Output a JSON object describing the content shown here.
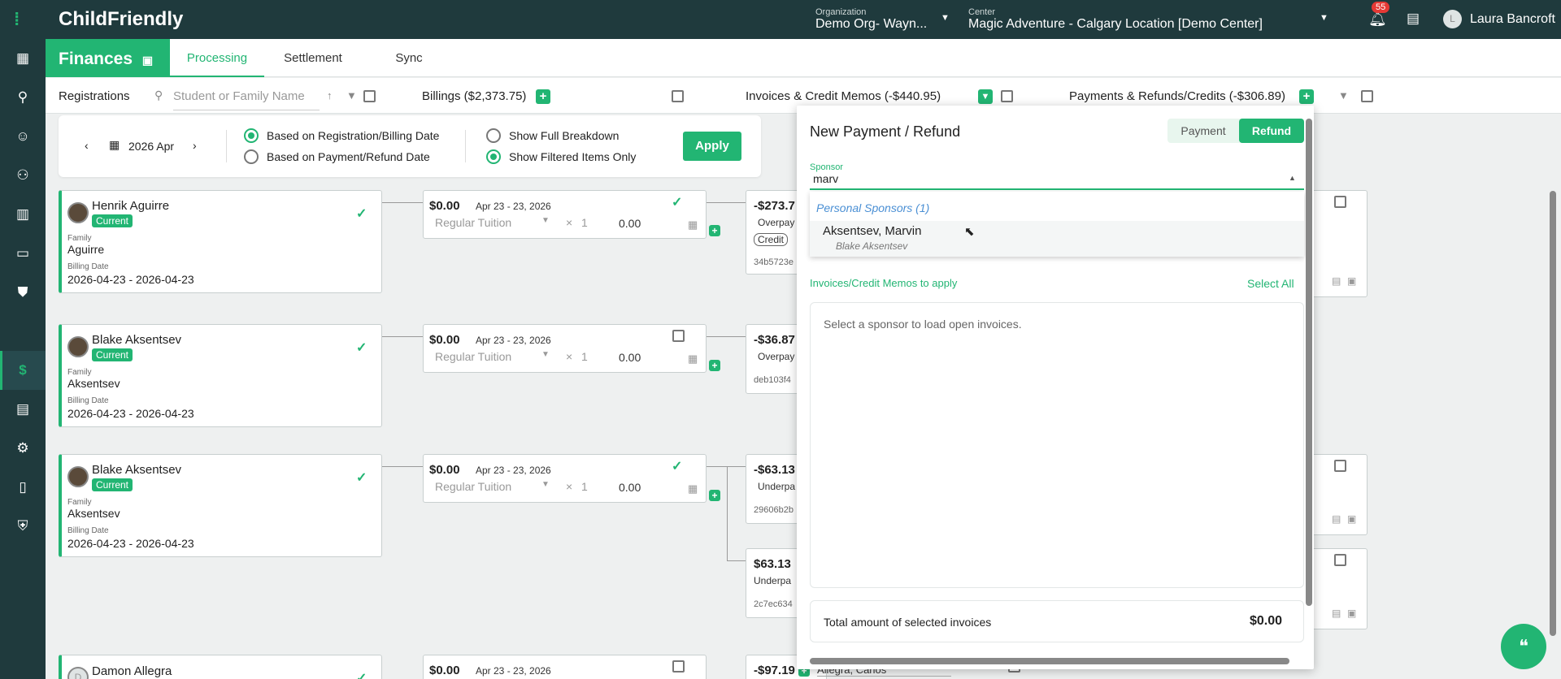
{
  "top": {
    "app_name": "ChildFriendly",
    "org_label": "Organization",
    "org_value": "Demo Org- Wayn...",
    "center_label": "Center",
    "center_value": "Magic Adventure - Calgary Location [Demo Center]",
    "notif_count": "55",
    "user_initial": "L",
    "user_name": "Laura Bancroft"
  },
  "subnav": {
    "section": "Finances",
    "tabs": [
      "Processing",
      "Settlement",
      "Sync"
    ]
  },
  "filterbar": {
    "registrations": "Registrations",
    "search_placeholder": "Student or Family Name",
    "billings": "Billings ($2,373.75)",
    "invoices": "Invoices & Credit Memos (-$440.95)",
    "payments": "Payments & Refunds/Credits (-$306.89)"
  },
  "datebar": {
    "month": "2026 Apr",
    "radio1": "Based on Registration/Billing Date",
    "radio2": "Based on Payment/Refund Date",
    "radio3": "Show Full Breakdown",
    "radio4": "Show Filtered Items Only",
    "apply": "Apply"
  },
  "registrations": [
    {
      "name": "Henrik Aguirre",
      "status": "Current",
      "family_label": "Family",
      "family": "Aguirre",
      "billing_label": "Billing Date",
      "billing": "2026-04-23 - 2026-04-23"
    },
    {
      "name": "Blake Aksentsev",
      "status": "Current",
      "family_label": "Family",
      "family": "Aksentsev",
      "billing_label": "Billing Date",
      "billing": "2026-04-23 - 2026-04-23"
    },
    {
      "name": "Blake Aksentsev",
      "status": "Current",
      "family_label": "Family",
      "family": "Aksentsev",
      "billing_label": "Billing Date",
      "billing": "2026-04-23 - 2026-04-23"
    },
    {
      "name": "Damon Allegra",
      "initial": "D"
    }
  ],
  "billings": [
    {
      "amount": "$0.00",
      "dates": "Apr 23 - 23, 2026",
      "type": "Regular Tuition",
      "mult": "×",
      "qty": "1",
      "total": "0.00"
    },
    {
      "amount": "$0.00",
      "dates": "Apr 23 - 23, 2026",
      "type": "Regular Tuition",
      "mult": "×",
      "qty": "1",
      "total": "0.00"
    },
    {
      "amount": "$0.00",
      "dates": "Apr 23 - 23, 2026",
      "type": "Regular Tuition",
      "mult": "×",
      "qty": "1",
      "total": "0.00"
    },
    {
      "amount": "$0.00",
      "dates": "Apr 23 - 23, 2026"
    }
  ],
  "invoices": [
    {
      "amount": "-$273.7",
      "type": "Overpay",
      "tag": "Credit",
      "id": "34b5723e"
    },
    {
      "amount": "-$36.87",
      "type": "Overpay",
      "id": "deb103f4"
    },
    {
      "amount": "-$63.13",
      "type": "Underpa",
      "id": "29606b2b"
    },
    {
      "amount": "$63.13",
      "type": "Underpa",
      "id": "2c7ec634"
    },
    {
      "amount": "-$97.19",
      "sponsor": "Allegra, Carlos"
    }
  ],
  "modal": {
    "title": "New Payment / Refund",
    "toggle_payment": "Payment",
    "toggle_refund": "Refund",
    "sponsor_label": "Sponsor",
    "sponsor_value": "marv",
    "dropdown_group": "Personal Sponsors (1)",
    "option_name": "Aksentsev, Marvin",
    "option_sub": "Blake Aksentsev",
    "invoices_label": "Invoices/Credit Memos to apply",
    "select_all": "Select All",
    "empty_msg": "Select a sponsor to load open invoices.",
    "total_label": "Total amount of selected invoices",
    "total_value": "$0.00"
  },
  "colors": {
    "accent": "#22b573",
    "dark": "#1f3a3d",
    "notif": "#e53935"
  },
  "icons": [
    "apps-icon",
    "person-icon",
    "child-icon",
    "family-icon",
    "book-icon",
    "chat-icon",
    "school-icon",
    "dollar-icon",
    "document-icon",
    "gear-icon",
    "tablet-icon",
    "security-icon"
  ]
}
